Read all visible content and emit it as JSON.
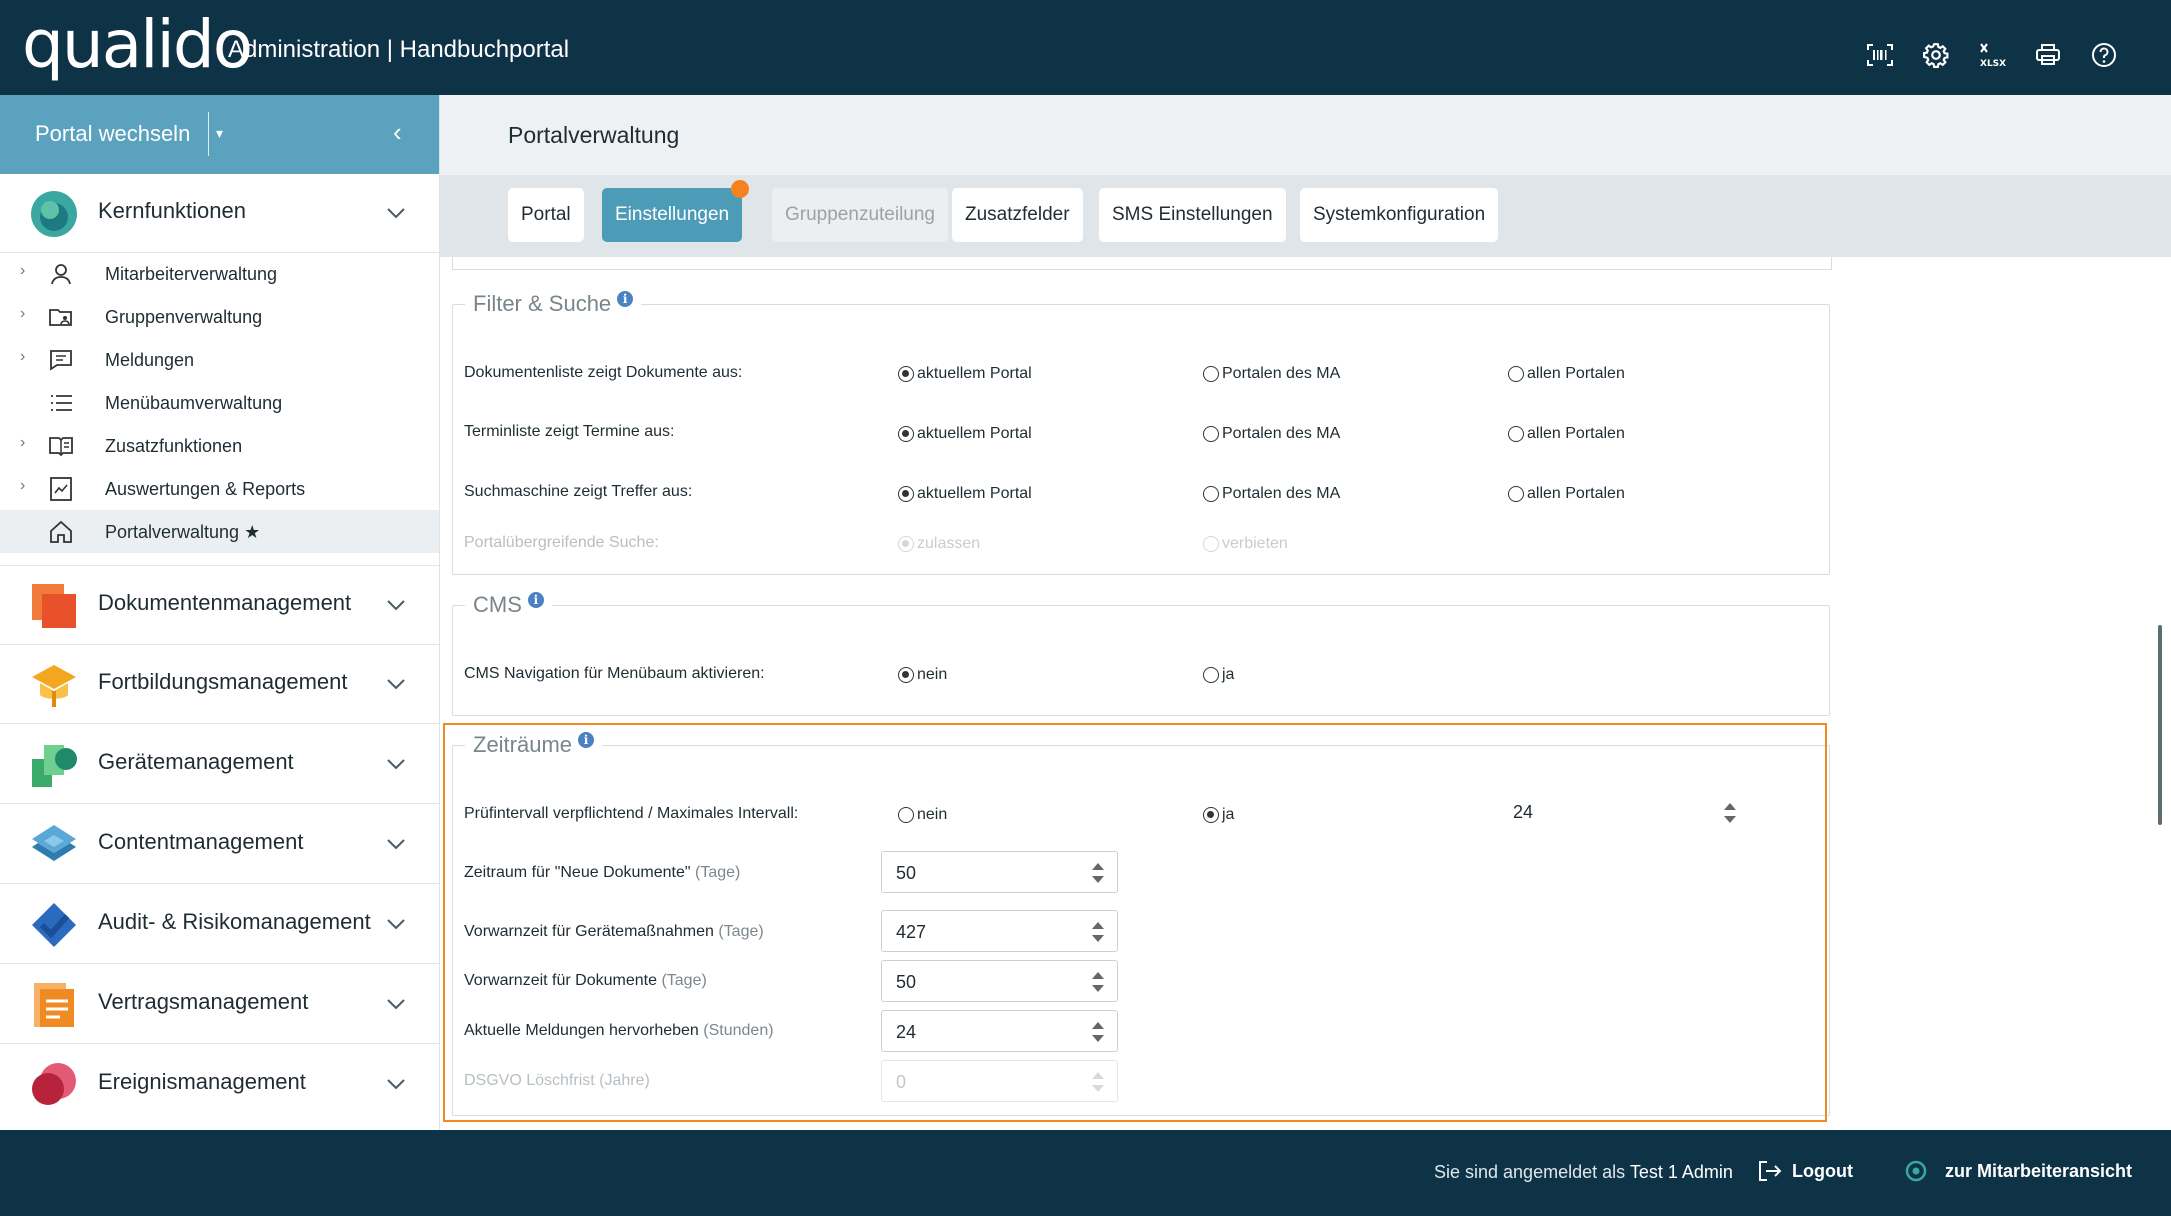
{
  "header": {
    "logo": "qualido",
    "title": "Administration | Handbuchportal",
    "icons": [
      "barcode-icon",
      "gear-icon",
      "xlsx-icon",
      "printer-icon",
      "help-icon"
    ]
  },
  "sidebar": {
    "portal_switch": "Portal wechseln",
    "groups": [
      {
        "label": "Kernfunktionen",
        "icon": "kernfunktionen-icon",
        "color": "#3aa7a0"
      },
      {
        "label": "Dokumentenmanagement",
        "icon": "dokumente-icon",
        "color": "#e8512a"
      },
      {
        "label": "Fortbildungsmanagement",
        "icon": "fortbildung-icon",
        "color": "#f3a71e"
      },
      {
        "label": "Gerätemanagement",
        "icon": "geraete-icon",
        "color": "#3aaa6a"
      },
      {
        "label": "Contentmanagement",
        "icon": "content-icon",
        "color": "#2f7db0"
      },
      {
        "label": "Audit- & Risikomanagement",
        "icon": "audit-icon",
        "color": "#2a6bc0"
      },
      {
        "label": "Vertragsmanagement",
        "icon": "vertrag-icon",
        "color": "#f08a23"
      },
      {
        "label": "Ereignismanagement",
        "icon": "ereignis-icon",
        "color": "#d4374f"
      }
    ],
    "items": [
      {
        "label": "Mitarbeiterverwaltung",
        "icon": "user-icon"
      },
      {
        "label": "Gruppenverwaltung",
        "icon": "folder-group-icon"
      },
      {
        "label": "Meldungen",
        "icon": "message-icon"
      },
      {
        "label": "Menübaumverwaltung",
        "icon": "list-icon"
      },
      {
        "label": "Zusatzfunktionen",
        "icon": "book-icon"
      },
      {
        "label": "Auswertungen & Reports",
        "icon": "report-icon"
      },
      {
        "label": "Portalverwaltung ★",
        "icon": "home-icon"
      }
    ]
  },
  "main": {
    "page_title": "Portalverwaltung",
    "tabs": [
      {
        "label": "Portal"
      },
      {
        "label": "Einstellungen"
      },
      {
        "label": "Gruppenzuteilung"
      },
      {
        "label": "Zusatzfelder"
      },
      {
        "label": "SMS Einstellungen"
      },
      {
        "label": "Systemkonfiguration"
      }
    ],
    "filter": {
      "legend": "Filter & Suche",
      "rows": [
        {
          "label": "Dokumentenliste zeigt Dokumente aus:",
          "options": [
            "aktuellem Portal",
            "Portalen des MA",
            "allen Portalen"
          ],
          "selected": "aktuellem Portal"
        },
        {
          "label": "Terminliste zeigt Termine aus:",
          "options": [
            "aktuellem Portal",
            "Portalen des MA",
            "allen Portalen"
          ],
          "selected": "aktuellem Portal"
        },
        {
          "label": "Suchmaschine zeigt Treffer aus:",
          "options": [
            "aktuellem Portal",
            "Portalen des MA",
            "allen Portalen"
          ],
          "selected": "aktuellem Portal"
        },
        {
          "label": "Portalübergreifende Suche:",
          "options": [
            "zulassen",
            "verbieten"
          ],
          "selected": "zulassen",
          "disabled": true
        }
      ]
    },
    "cms": {
      "legend": "CMS",
      "label": "CMS Navigation für Menübaum aktivieren:",
      "options": [
        "nein",
        "ja"
      ],
      "selected": "nein"
    },
    "zeitraeume": {
      "legend": "Zeiträume",
      "pruef": {
        "label": "Prüfintervall verpflichtend / Maximales Intervall:",
        "options": [
          "nein",
          "ja"
        ],
        "selected": "ja",
        "value": "24"
      },
      "fields": [
        {
          "label": "Zeitraum für \"Neue Dokumente\"",
          "unit": "(Tage)",
          "value": "50"
        },
        {
          "label": "Vorwarnzeit für Gerätemaßnahmen",
          "unit": "(Tage)",
          "value": "427"
        },
        {
          "label": "Vorwarnzeit für Dokumente",
          "unit": "(Tage)",
          "value": "50"
        },
        {
          "label": "Aktuelle Meldungen hervorheben",
          "unit": "(Stunden)",
          "value": "24"
        },
        {
          "label": "DSGVO Löschfrist",
          "unit": "(Jahre)",
          "value": "0",
          "disabled": true
        }
      ]
    }
  },
  "footer": {
    "logged_in_prefix": "Sie sind angemeldet als",
    "user": "Test 1 Admin",
    "logout": "Logout",
    "switch_view": "zur Mitarbeiteransicht"
  }
}
